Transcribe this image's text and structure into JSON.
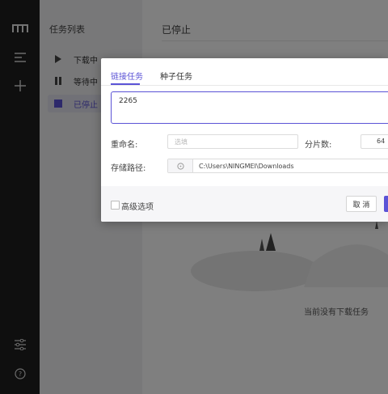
{
  "rail": {
    "logo_icon": "logo-icon",
    "items": [
      "menu-icon",
      "add-icon"
    ],
    "bottom_items": [
      "preferences-icon",
      "help-icon"
    ]
  },
  "task_list": {
    "heading": "任务列表",
    "items": [
      {
        "label": "下载中",
        "icon": "play-icon",
        "active": false
      },
      {
        "label": "等待中",
        "icon": "pause-icon",
        "active": false
      },
      {
        "label": "已停止",
        "icon": "stop-icon",
        "active": true
      }
    ]
  },
  "main": {
    "title": "已停止",
    "empty_text": "当前没有下载任务"
  },
  "dialog": {
    "tabs": [
      "链接任务",
      "种子任务"
    ],
    "active_tab": 0,
    "url_value": "2265",
    "rename_label": "重命名:",
    "rename_placeholder": "选填",
    "split_label": "分片数:",
    "split_value": "64",
    "dir_label": "存储路径:",
    "dir_value": "C:\\Users\\NINGMEI\\Downloads",
    "advanced_label": "高级选项",
    "cancel_label": "取 消"
  },
  "colors": {
    "accent": "#5b53d6",
    "rail": "#1f1f1f"
  }
}
